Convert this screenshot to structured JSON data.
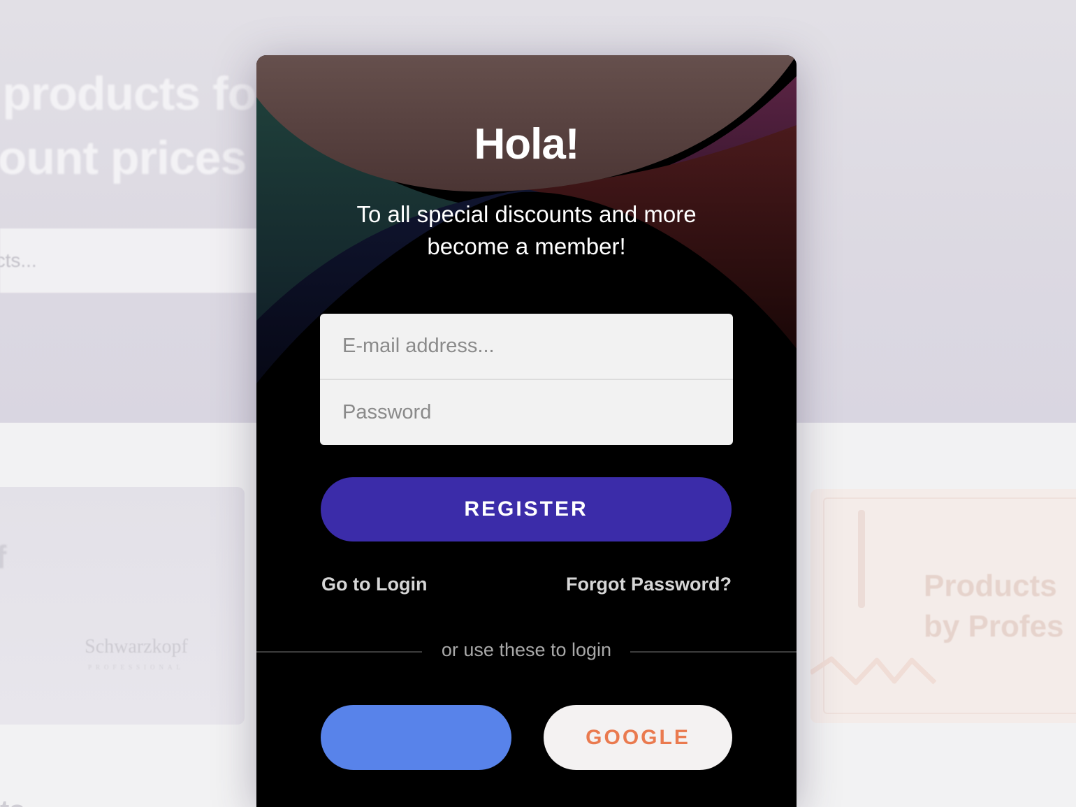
{
  "background": {
    "hero_title_line1": "r products fo",
    "hero_title_line2": "count prices",
    "search_placeholder": "ucts...",
    "left_card_letter": "f",
    "left_card_brand": "Schwarzkopf",
    "left_card_brand_sub": "PROFESSIONAL",
    "right_card_title_line1": "Products",
    "right_card_title_line2": "by Profes",
    "bottom_text": "ts"
  },
  "modal": {
    "title": "Hola!",
    "subtitle_line1": "To all special discounts and more",
    "subtitle_line2": "become a member!",
    "form": {
      "email_placeholder": "E-mail address...",
      "password_placeholder": "Password"
    },
    "register_label": "REGISTER",
    "go_to_login_label": "Go to Login",
    "forgot_password_label": "Forgot Password?",
    "divider_text": "or use these to login",
    "social": {
      "facebook_label": "",
      "google_label": "GOOGLE"
    }
  },
  "colors": {
    "register_button": "#3b2ca9",
    "facebook_button": "#5883ea",
    "google_button_bg": "#f4f2f2",
    "google_text": "#ea7a4f",
    "modal_bg": "#000000"
  }
}
